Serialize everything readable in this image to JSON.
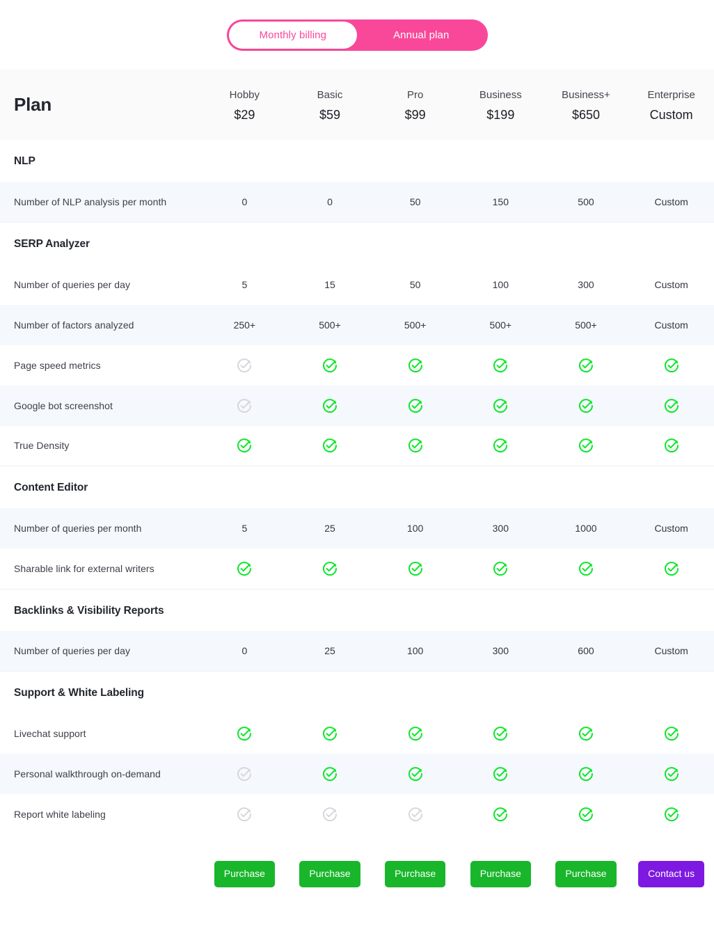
{
  "billing_toggle": {
    "monthly_label": "Monthly billing",
    "annual_label": "Annual plan",
    "selected": "Monthly billing",
    "active_color": "#f9489a"
  },
  "header": {
    "title": "Plan",
    "plans": [
      {
        "name": "Hobby",
        "price": "$29"
      },
      {
        "name": "Basic",
        "price": "$59"
      },
      {
        "name": "Pro",
        "price": "$99"
      },
      {
        "name": "Business",
        "price": "$199"
      },
      {
        "name": "Business+",
        "price": "$650"
      },
      {
        "name": "Enterprise",
        "price": "Custom"
      }
    ]
  },
  "icons": {
    "check_active": "check-circle-icon",
    "check_inactive": "check-circle-disabled-icon",
    "active_color": "#0ce629",
    "inactive_color": "#d5d7dc"
  },
  "sections": [
    {
      "title": "NLP",
      "rows": [
        {
          "feature": "Number of NLP analysis per month",
          "type": "value",
          "values": [
            "0",
            "0",
            "50",
            "150",
            "500",
            "Custom"
          ]
        }
      ]
    },
    {
      "title": "SERP Analyzer",
      "rows": [
        {
          "feature": "Number of queries per day",
          "type": "value",
          "values": [
            "5",
            "15",
            "50",
            "100",
            "300",
            "Custom"
          ]
        },
        {
          "feature": "Number of factors analyzed",
          "type": "value",
          "values": [
            "250+",
            "500+",
            "500+",
            "500+",
            "500+",
            "Custom"
          ]
        },
        {
          "feature": "Page speed metrics",
          "type": "icon",
          "values": [
            false,
            true,
            true,
            true,
            true,
            true
          ]
        },
        {
          "feature": "Google bot screenshot",
          "type": "icon",
          "values": [
            false,
            true,
            true,
            true,
            true,
            true
          ]
        },
        {
          "feature": "True Density",
          "type": "icon",
          "values": [
            true,
            true,
            true,
            true,
            true,
            true
          ]
        }
      ]
    },
    {
      "title": "Content Editor",
      "rows": [
        {
          "feature": "Number of queries per month",
          "type": "value",
          "values": [
            "5",
            "25",
            "100",
            "300",
            "1000",
            "Custom"
          ]
        },
        {
          "feature": "Sharable link for external writers",
          "type": "icon",
          "values": [
            true,
            true,
            true,
            true,
            true,
            true
          ]
        }
      ]
    },
    {
      "title": "Backlinks & Visibility Reports",
      "rows": [
        {
          "feature": "Number of queries per day",
          "type": "value",
          "values": [
            "0",
            "25",
            "100",
            "300",
            "600",
            "Custom"
          ]
        }
      ]
    },
    {
      "title": "Support & White Labeling",
      "rows": [
        {
          "feature": "Livechat support",
          "type": "icon",
          "values": [
            true,
            true,
            true,
            true,
            true,
            true
          ]
        },
        {
          "feature": "Personal walkthrough on-demand",
          "type": "icon",
          "values": [
            false,
            true,
            true,
            true,
            true,
            true
          ]
        },
        {
          "feature": "Report white labeling",
          "type": "icon",
          "values": [
            false,
            false,
            false,
            true,
            true,
            true
          ]
        }
      ]
    }
  ],
  "cta": {
    "buttons": [
      {
        "label": "Purchase",
        "style": "purchase"
      },
      {
        "label": "Purchase",
        "style": "purchase"
      },
      {
        "label": "Purchase",
        "style": "purchase"
      },
      {
        "label": "Purchase",
        "style": "purchase"
      },
      {
        "label": "Purchase",
        "style": "purchase"
      },
      {
        "label": "Contact us",
        "style": "contact"
      }
    ],
    "purchase_color": "#19b62b",
    "contact_color": "#7d19e0"
  }
}
